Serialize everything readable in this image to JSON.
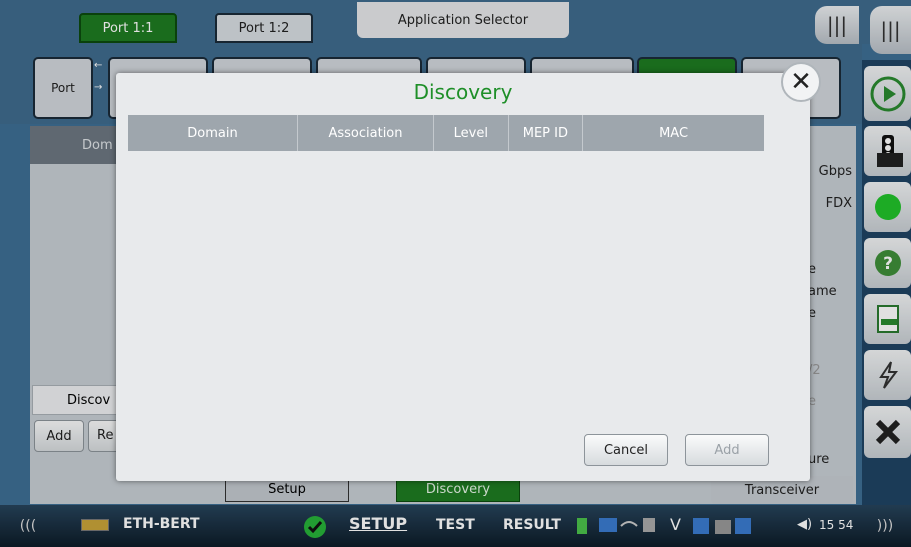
{
  "topbar": {
    "port_tabs": [
      "Port 1:1",
      "Port 1:2"
    ],
    "app_selector": "Application Selector",
    "grip_symbol": "|||"
  },
  "tabs_row": {
    "port_label": "Port"
  },
  "background": {
    "left_header": "Dom",
    "discovery_label": "Discov",
    "add_label": "Add",
    "remove_label": "Re",
    "right_values": [
      "Gbps",
      "FDX",
      "e",
      "ame",
      "e",
      "/2",
      "e",
      "ure"
    ],
    "transceiver_label": "Transceiver",
    "bottom_tabs": [
      "Setup",
      "Discovery"
    ]
  },
  "bottombar": {
    "app_name": "ETH-BERT",
    "nav": [
      "SETUP",
      "TEST",
      "RESULT"
    ],
    "time": "15 54",
    "left_arrows": "(((",
    "right_arrows": ")))",
    "status_v": "V"
  },
  "dialog": {
    "title": "Discovery",
    "columns": [
      "Domain",
      "Association",
      "Level",
      "MEP ID",
      "MAC"
    ],
    "rows": [],
    "cancel_label": "Cancel",
    "add_label": "Add",
    "close_symbol": "✕"
  },
  "colors": {
    "accent_green": "#1e8f28",
    "port_active": "#1e7b22",
    "header_gray": "#9ea6ad"
  }
}
